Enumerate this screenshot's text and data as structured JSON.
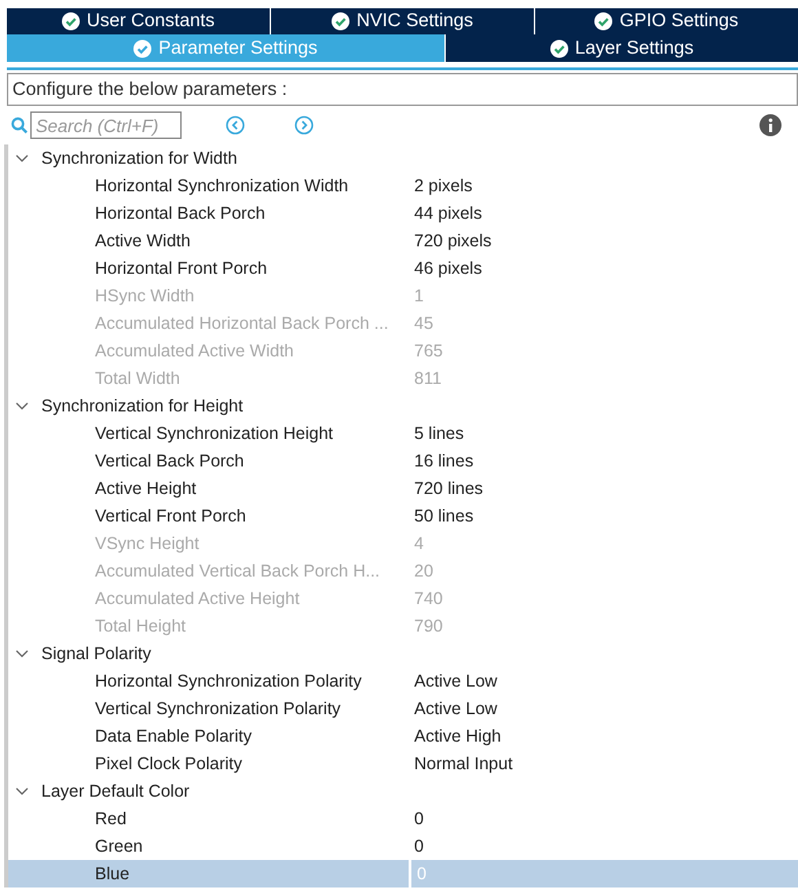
{
  "tab_rows": [
    [
      {
        "label": "User Constants",
        "selected": false
      },
      {
        "label": "NVIC Settings",
        "selected": false
      },
      {
        "label": "GPIO Settings",
        "selected": false
      }
    ],
    [
      {
        "label": "Parameter Settings",
        "selected": true
      },
      {
        "label": "Layer Settings",
        "selected": false
      }
    ]
  ],
  "instruction": "Configure the below parameters :",
  "search": {
    "placeholder": "Search (Ctrl+F)"
  },
  "groups": [
    {
      "label": "Synchronization for Width",
      "expanded": true,
      "items": [
        {
          "label": "Horizontal Synchronization Width",
          "value": "2 pixels",
          "disabled": false,
          "selected": false
        },
        {
          "label": "Horizontal Back Porch",
          "value": "44 pixels",
          "disabled": false,
          "selected": false
        },
        {
          "label": "Active Width",
          "value": "720 pixels",
          "disabled": false,
          "selected": false
        },
        {
          "label": "Horizontal Front Porch",
          "value": "46 pixels",
          "disabled": false,
          "selected": false
        },
        {
          "label": "HSync Width",
          "value": "1",
          "disabled": true,
          "selected": false
        },
        {
          "label": "Accumulated Horizontal Back Porch ...",
          "value": "45",
          "disabled": true,
          "selected": false
        },
        {
          "label": "Accumulated Active Width",
          "value": "765",
          "disabled": true,
          "selected": false
        },
        {
          "label": "Total Width",
          "value": "811",
          "disabled": true,
          "selected": false
        }
      ]
    },
    {
      "label": "Synchronization for Height",
      "expanded": true,
      "items": [
        {
          "label": "Vertical Synchronization Height",
          "value": "5 lines",
          "disabled": false,
          "selected": false
        },
        {
          "label": "Vertical Back Porch",
          "value": "16 lines",
          "disabled": false,
          "selected": false
        },
        {
          "label": "Active Height",
          "value": "720 lines",
          "disabled": false,
          "selected": false
        },
        {
          "label": "Vertical Front Porch",
          "value": "50 lines",
          "disabled": false,
          "selected": false
        },
        {
          "label": "VSync Height",
          "value": "4",
          "disabled": true,
          "selected": false
        },
        {
          "label": "Accumulated Vertical Back Porch H...",
          "value": "20",
          "disabled": true,
          "selected": false
        },
        {
          "label": "Accumulated Active Height",
          "value": "740",
          "disabled": true,
          "selected": false
        },
        {
          "label": "Total Height",
          "value": "790",
          "disabled": true,
          "selected": false
        }
      ]
    },
    {
      "label": "Signal Polarity",
      "expanded": true,
      "items": [
        {
          "label": "Horizontal Synchronization Polarity",
          "value": "Active Low",
          "disabled": false,
          "selected": false
        },
        {
          "label": "Vertical Synchronization Polarity",
          "value": "Active Low",
          "disabled": false,
          "selected": false
        },
        {
          "label": "Data Enable Polarity",
          "value": "Active High",
          "disabled": false,
          "selected": false
        },
        {
          "label": "Pixel Clock Polarity",
          "value": "Normal Input",
          "disabled": false,
          "selected": false
        }
      ]
    },
    {
      "label": "Layer Default Color",
      "expanded": true,
      "items": [
        {
          "label": "Red",
          "value": "0",
          "disabled": false,
          "selected": false
        },
        {
          "label": "Green",
          "value": "0",
          "disabled": false,
          "selected": false
        },
        {
          "label": "Blue",
          "value": "0",
          "disabled": false,
          "selected": true
        }
      ]
    }
  ]
}
